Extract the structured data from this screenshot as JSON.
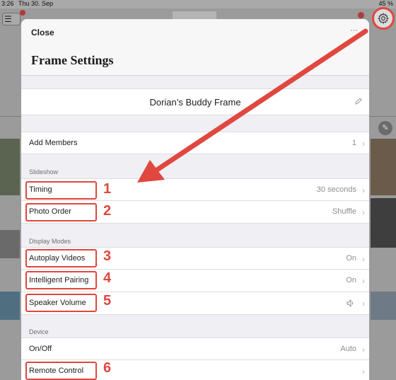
{
  "status_bar": {
    "time": "3:26",
    "date": "Thu 30. Sep",
    "battery": "45 %"
  },
  "modal": {
    "close_label": "Close",
    "more_label": "···",
    "title": "Frame Settings",
    "frame_name": "Dorian’s Buddy Frame"
  },
  "members": {
    "label": "Add Members",
    "value": "1"
  },
  "sections": {
    "slideshow": "Slideshow",
    "display_modes": "Display Modes",
    "device": "Device"
  },
  "rows": {
    "timing": {
      "label": "Timing",
      "value": "30 seconds"
    },
    "photo_order": {
      "label": "Photo Order",
      "value": "Shuffle"
    },
    "autoplay_videos": {
      "label": "Autoplay Videos",
      "value": "On"
    },
    "intelligent_pairing": {
      "label": "Intelligent Pairing",
      "value": "On"
    },
    "speaker_volume": {
      "label": "Speaker Volume",
      "value": ""
    },
    "on_off": {
      "label": "On/Off",
      "value": "Auto"
    },
    "remote_control": {
      "label": "Remote Control",
      "value": ""
    }
  },
  "chevron": "›",
  "annotations": {
    "n1": "1",
    "n2": "2",
    "n3": "3",
    "n4": "4",
    "n5": "5",
    "n6": "6"
  },
  "colors": {
    "annotation_red": "#e0473e",
    "modal_bg": "#efeff4",
    "row_bg": "#ffffff"
  },
  "icons": [
    "gear-icon",
    "menu-icon",
    "pencil-icon",
    "speaker-icon",
    "chevron-right-icon"
  ]
}
